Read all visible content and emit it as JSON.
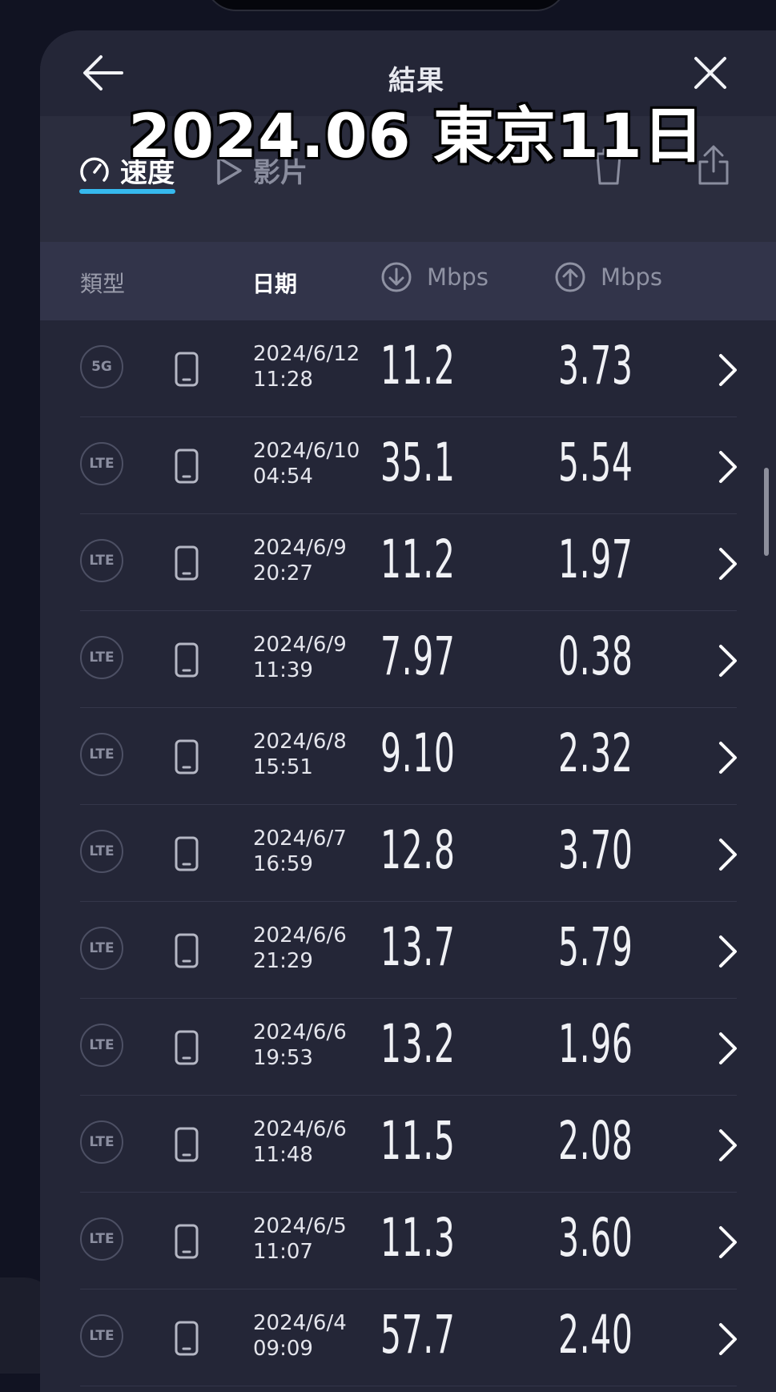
{
  "header": {
    "title": "結果",
    "overlay_text": "2024.06 東京11日"
  },
  "tabs": [
    {
      "label": "速度",
      "icon": "speedometer-icon",
      "active": true
    },
    {
      "label": "影片",
      "icon": "play-icon",
      "active": false
    }
  ],
  "columns": {
    "type": "類型",
    "date": "日期",
    "download_unit": "Mbps",
    "upload_unit": "Mbps"
  },
  "colors": {
    "accent": "#36b9ee",
    "panel": "#242637",
    "background": "#111322"
  },
  "results": [
    {
      "network": "5G",
      "date": "2024/6/12",
      "time": "11:28",
      "download": "11.2",
      "upload": "3.73"
    },
    {
      "network": "LTE",
      "date": "2024/6/10",
      "time": "04:54",
      "download": "35.1",
      "upload": "5.54"
    },
    {
      "network": "LTE",
      "date": "2024/6/9",
      "time": "20:27",
      "download": "11.2",
      "upload": "1.97"
    },
    {
      "network": "LTE",
      "date": "2024/6/9",
      "time": "11:39",
      "download": "7.97",
      "upload": "0.38"
    },
    {
      "network": "LTE",
      "date": "2024/6/8",
      "time": "15:51",
      "download": "9.10",
      "upload": "2.32"
    },
    {
      "network": "LTE",
      "date": "2024/6/7",
      "time": "16:59",
      "download": "12.8",
      "upload": "3.70"
    },
    {
      "network": "LTE",
      "date": "2024/6/6",
      "time": "21:29",
      "download": "13.7",
      "upload": "5.79"
    },
    {
      "network": "LTE",
      "date": "2024/6/6",
      "time": "19:53",
      "download": "13.2",
      "upload": "1.96"
    },
    {
      "network": "LTE",
      "date": "2024/6/6",
      "time": "11:48",
      "download": "11.5",
      "upload": "2.08"
    },
    {
      "network": "LTE",
      "date": "2024/6/5",
      "time": "11:07",
      "download": "11.3",
      "upload": "3.60"
    },
    {
      "network": "LTE",
      "date": "2024/6/4",
      "time": "09:09",
      "download": "57.7",
      "upload": "2.40"
    }
  ]
}
